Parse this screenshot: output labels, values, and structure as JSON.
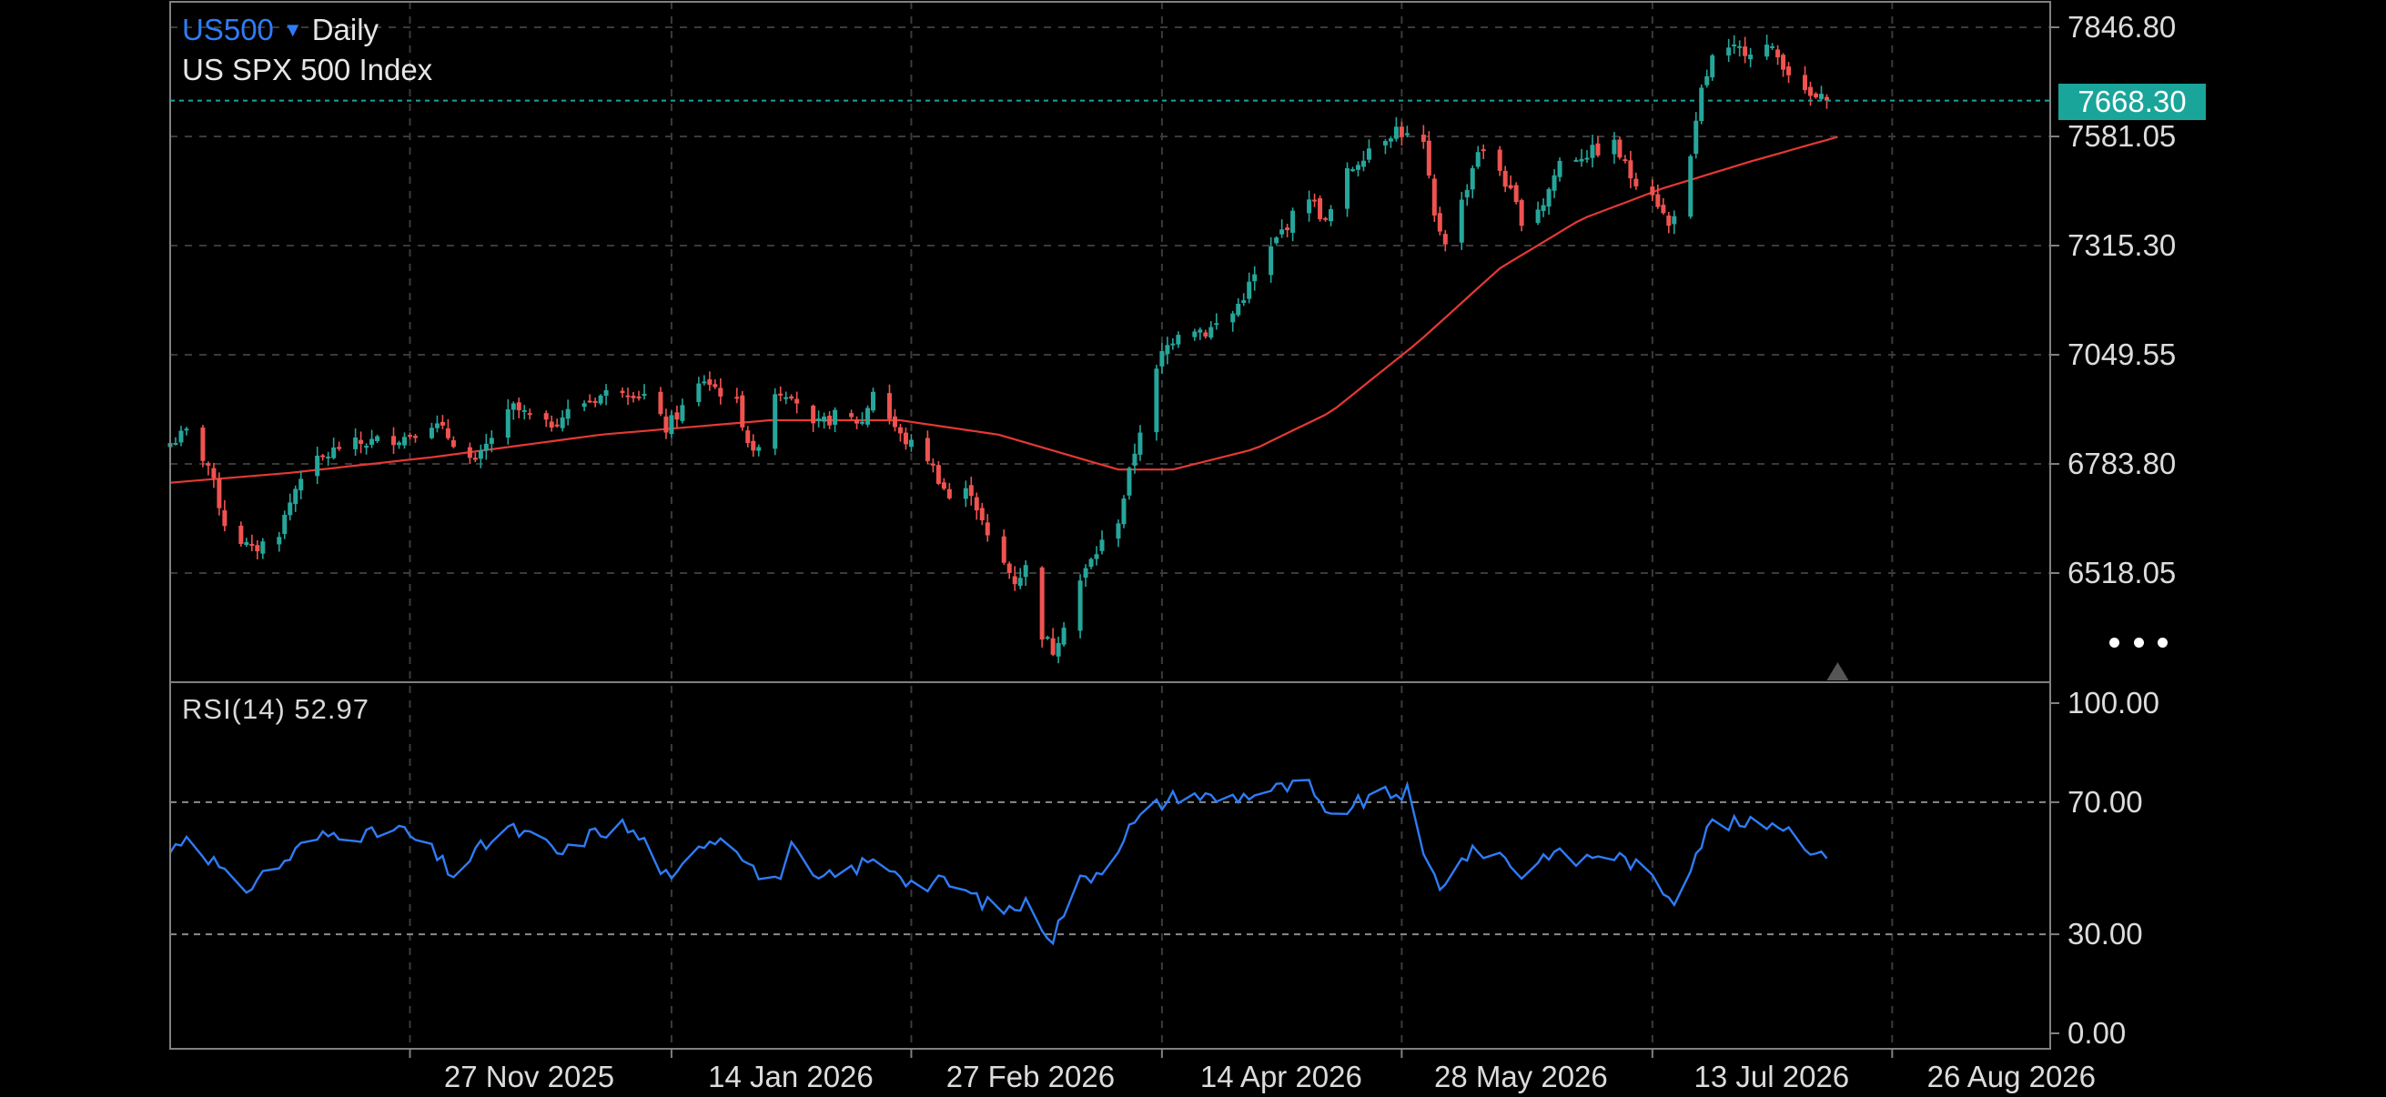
{
  "header": {
    "symbol": "US500",
    "timeframe": "Daily",
    "instrument_name": "US SPX 500 Index"
  },
  "last_price_label": "7668.30",
  "rsi_label": "RSI(14) 52.97",
  "colors": {
    "up": "#26a69a",
    "down": "#ef5350",
    "ma_line": "#e53935",
    "rsi_line": "#2f7cf6",
    "grid": "#3a3a3a",
    "axis": "#808080",
    "badge": "#1aa59a",
    "symbol": "#2f7cf6"
  },
  "icons": {
    "more": "more-dots-icon",
    "marker": "triangle-up-icon",
    "caret": "caret-down-icon"
  },
  "chart_data": [
    {
      "type": "candlestick",
      "title": "US SPX 500 Index",
      "x_range": [
        "2025-10-14",
        "2026-09-24"
      ],
      "x_ticks": [
        "27 Nov 2025",
        "14 Jan 2026",
        "27 Feb 2026",
        "14 Apr 2026",
        "28 May 2026",
        "13 Jul 2026",
        "26 Aug 2026"
      ],
      "y_ticks": [
        "7846.80",
        "7581.05",
        "7315.30",
        "7049.55",
        "6783.80",
        "6518.05"
      ],
      "ylim": [
        6270,
        7860
      ],
      "last_price": 7668.3,
      "grid": true,
      "close_anchors": [
        [
          "2025-10-14",
          6835
        ],
        [
          "2025-10-17",
          6860
        ],
        [
          "2025-10-21",
          6780
        ],
        [
          "2025-10-24",
          6640
        ],
        [
          "2025-10-29",
          6570
        ],
        [
          "2025-11-03",
          6620
        ],
        [
          "2025-11-07",
          6760
        ],
        [
          "2025-11-14",
          6825
        ],
        [
          "2025-11-21",
          6840
        ],
        [
          "2025-11-26",
          6850
        ],
        [
          "2025-12-01",
          6885
        ],
        [
          "2025-12-05",
          6840
        ],
        [
          "2025-12-09",
          6780
        ],
        [
          "2025-12-12",
          6850
        ],
        [
          "2025-12-16",
          6920
        ],
        [
          "2025-12-22",
          6875
        ],
        [
          "2025-12-29",
          6935
        ],
        [
          "2026-01-05",
          6970
        ],
        [
          "2026-01-09",
          6950
        ],
        [
          "2026-01-13",
          6870
        ],
        [
          "2026-01-16",
          6920
        ],
        [
          "2026-01-20",
          6990
        ],
        [
          "2026-01-26",
          6930
        ],
        [
          "2026-01-29",
          6800
        ],
        [
          "2026-02-02",
          6960
        ],
        [
          "2026-02-05",
          6960
        ],
        [
          "2026-02-09",
          6870
        ],
        [
          "2026-02-13",
          6900
        ],
        [
          "2026-02-18",
          6885
        ],
        [
          "2026-02-20",
          6965
        ],
        [
          "2026-02-25",
          6850
        ],
        [
          "2026-03-02",
          6800
        ],
        [
          "2026-03-06",
          6700
        ],
        [
          "2026-03-10",
          6720
        ],
        [
          "2026-03-13",
          6600
        ],
        [
          "2026-03-18",
          6500
        ],
        [
          "2026-03-20",
          6530
        ],
        [
          "2026-03-23",
          6370
        ],
        [
          "2026-03-25",
          6330
        ],
        [
          "2026-03-30",
          6500
        ],
        [
          "2026-04-02",
          6570
        ],
        [
          "2026-04-06",
          6650
        ],
        [
          "2026-04-10",
          6870
        ],
        [
          "2026-04-14",
          7050
        ],
        [
          "2026-04-18",
          7130
        ],
        [
          "2026-04-22",
          7105
        ],
        [
          "2026-04-27",
          7150
        ],
        [
          "2026-05-01",
          7240
        ],
        [
          "2026-05-06",
          7350
        ],
        [
          "2026-05-11",
          7440
        ],
        [
          "2026-05-14",
          7370
        ],
        [
          "2026-05-18",
          7490
        ],
        [
          "2026-05-22",
          7555
        ],
        [
          "2026-05-27",
          7600
        ],
        [
          "2026-05-29",
          7580
        ],
        [
          "2026-06-01",
          7560
        ],
        [
          "2026-06-03",
          7380
        ],
        [
          "2026-06-05",
          7330
        ],
        [
          "2026-06-08",
          7420
        ],
        [
          "2026-06-11",
          7550
        ],
        [
          "2026-06-15",
          7500
        ],
        [
          "2026-06-19",
          7380
        ],
        [
          "2026-06-23",
          7420
        ],
        [
          "2026-06-26",
          7520
        ],
        [
          "2026-07-01",
          7540
        ],
        [
          "2026-07-06",
          7560
        ],
        [
          "2026-07-09",
          7485
        ],
        [
          "2026-07-13",
          7450
        ],
        [
          "2026-07-16",
          7360
        ],
        [
          "2026-07-20",
          7520
        ],
        [
          "2026-07-22",
          7690
        ],
        [
          "2026-07-24",
          7770
        ],
        [
          "2026-07-28",
          7790
        ],
        [
          "2026-08-03",
          7800
        ],
        [
          "2026-08-06",
          7760
        ],
        [
          "2026-08-10",
          7680
        ],
        [
          "2026-08-13",
          7670
        ],
        [
          "2026-08-16",
          7668
        ]
      ],
      "moving_average": [
        [
          "2025-10-14",
          6738
        ],
        [
          "2025-11-05",
          6762
        ],
        [
          "2025-12-01",
          6800
        ],
        [
          "2026-01-01",
          6855
        ],
        [
          "2026-02-01",
          6890
        ],
        [
          "2026-02-25",
          6890
        ],
        [
          "2026-03-15",
          6855
        ],
        [
          "2026-04-06",
          6770
        ],
        [
          "2026-04-16",
          6770
        ],
        [
          "2026-05-01",
          6820
        ],
        [
          "2026-05-15",
          6910
        ],
        [
          "2026-05-31",
          7080
        ],
        [
          "2026-06-15",
          7260
        ],
        [
          "2026-06-30",
          7380
        ],
        [
          "2026-07-15",
          7455
        ],
        [
          "2026-07-31",
          7520
        ],
        [
          "2026-08-16",
          7580
        ]
      ]
    },
    {
      "type": "line",
      "title": "RSI(14) 52.97",
      "value": 52.97,
      "ylim": [
        0,
        100
      ],
      "y_ticks": [
        "100.00",
        "70.00",
        "30.00",
        "0.00"
      ],
      "levels": [
        70,
        30
      ],
      "anchors": [
        [
          "2025-10-14",
          55
        ],
        [
          "2025-10-17",
          60
        ],
        [
          "2025-10-22",
          52
        ],
        [
          "2025-10-27",
          42
        ],
        [
          "2025-10-30",
          47
        ],
        [
          "2025-11-04",
          52
        ],
        [
          "2025-11-08",
          58
        ],
        [
          "2025-11-14",
          61
        ],
        [
          "2025-11-20",
          60
        ],
        [
          "2025-11-25",
          62
        ],
        [
          "2025-12-01",
          55
        ],
        [
          "2025-12-05",
          48
        ],
        [
          "2025-12-10",
          56
        ],
        [
          "2025-12-15",
          62
        ],
        [
          "2025-12-20",
          59
        ],
        [
          "2025-12-25",
          54
        ],
        [
          "2025-12-30",
          60
        ],
        [
          "2026-01-05",
          63
        ],
        [
          "2026-01-09",
          58
        ],
        [
          "2026-01-14",
          45
        ],
        [
          "2026-01-19",
          58
        ],
        [
          "2026-01-24",
          60
        ],
        [
          "2026-01-28",
          53
        ],
        [
          "2026-02-01",
          42
        ],
        [
          "2026-02-05",
          56
        ],
        [
          "2026-02-09",
          46
        ],
        [
          "2026-02-14",
          48
        ],
        [
          "2026-02-19",
          52
        ],
        [
          "2026-02-24",
          50
        ],
        [
          "2026-02-28",
          44
        ],
        [
          "2026-03-05",
          46
        ],
        [
          "2026-03-10",
          42
        ],
        [
          "2026-03-15",
          37
        ],
        [
          "2026-03-20",
          39
        ],
        [
          "2026-03-25",
          29
        ],
        [
          "2026-03-29",
          45
        ],
        [
          "2026-04-03",
          50
        ],
        [
          "2026-04-08",
          62
        ],
        [
          "2026-04-13",
          69
        ],
        [
          "2026-04-18",
          73
        ],
        [
          "2026-04-24",
          71
        ],
        [
          "2026-04-29",
          72
        ],
        [
          "2026-05-05",
          74
        ],
        [
          "2026-05-11",
          75
        ],
        [
          "2026-05-14",
          65
        ],
        [
          "2026-05-19",
          69
        ],
        [
          "2026-05-24",
          72
        ],
        [
          "2026-05-29",
          73
        ],
        [
          "2026-06-01",
          53
        ],
        [
          "2026-06-04",
          45
        ],
        [
          "2026-06-09",
          54
        ],
        [
          "2026-06-14",
          56
        ],
        [
          "2026-06-19",
          48
        ],
        [
          "2026-06-24",
          55
        ],
        [
          "2026-06-29",
          52
        ],
        [
          "2026-07-04",
          55
        ],
        [
          "2026-07-09",
          52
        ],
        [
          "2026-07-14",
          45
        ],
        [
          "2026-07-17",
          41
        ],
        [
          "2026-07-21",
          55
        ],
        [
          "2026-07-24",
          64
        ],
        [
          "2026-07-30",
          63
        ],
        [
          "2026-08-05",
          64
        ],
        [
          "2026-08-10",
          58
        ],
        [
          "2026-08-13",
          53
        ],
        [
          "2026-08-16",
          52.97
        ]
      ]
    }
  ]
}
